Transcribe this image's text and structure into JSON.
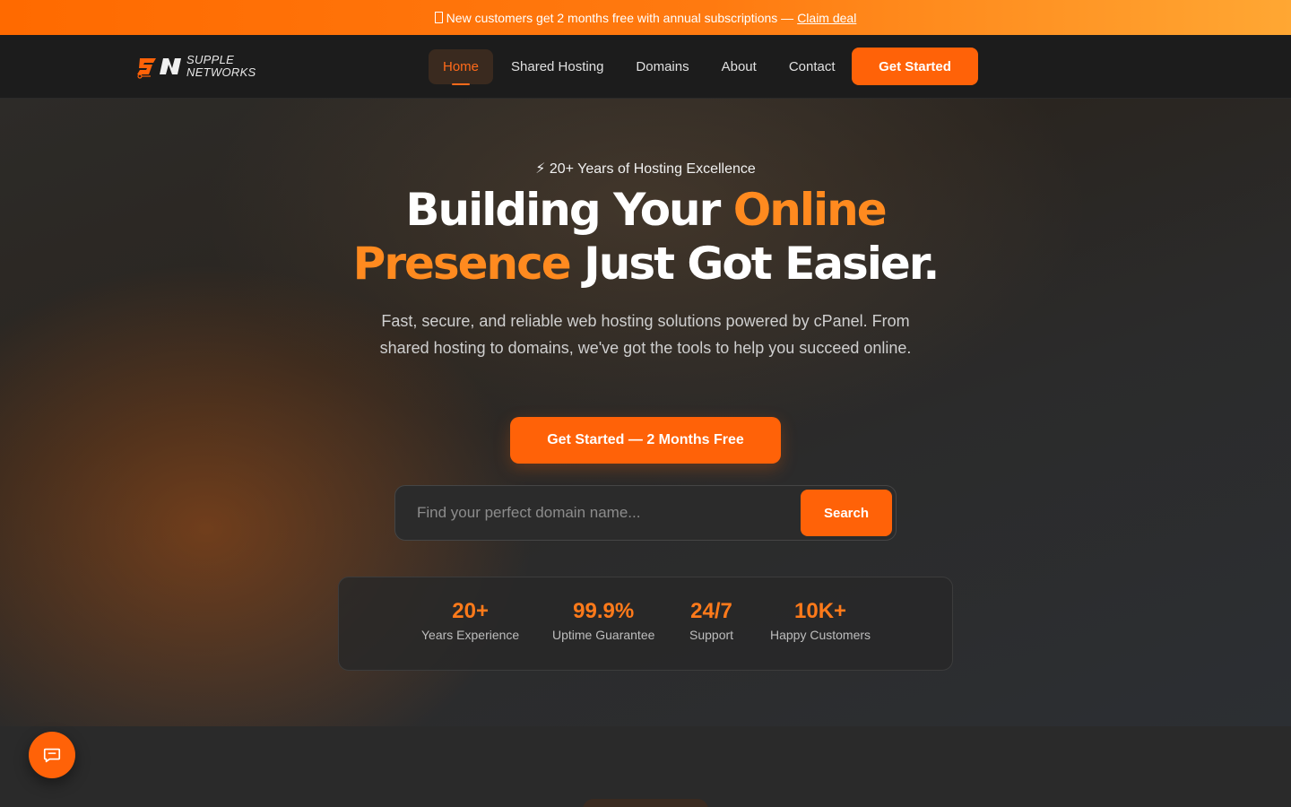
{
  "promo": {
    "icon": "gift-icon",
    "text": "New customers get 2 months free with annual subscriptions —",
    "link": "Claim deal"
  },
  "brand": {
    "line1": "SUPPLE",
    "line2": "NETWORKS",
    "accent_color": "#ff6208"
  },
  "nav": {
    "items": [
      {
        "label": "Home",
        "active": true
      },
      {
        "label": "Shared Hosting"
      },
      {
        "label": "Domains"
      },
      {
        "label": "About"
      },
      {
        "label": "Contact"
      }
    ],
    "cta": "Get Started"
  },
  "hero": {
    "eyebrow": "⚡ 20+ Years of Hosting Excellence",
    "headline": {
      "part1": "Building Your ",
      "accent1": "Online",
      "accent2": "Presence",
      "part2": " Just Got Easier."
    },
    "subtext": "Fast, secure, and reliable web hosting solutions powered by cPanel. From shared hosting to domains, we've got the tools to help you succeed online.",
    "cta": "Get Started — 2 Months Free"
  },
  "search": {
    "placeholder": "Find your perfect domain name...",
    "button": "Search"
  },
  "stats": [
    {
      "value": "20+",
      "label": "Years Experience"
    },
    {
      "value": "99.9%",
      "label": "Uptime Guarantee"
    },
    {
      "value": "24/7",
      "label": "Support"
    },
    {
      "value": "10K+",
      "label": "Happy Customers"
    }
  ],
  "chat": {
    "icon": "chat-icon"
  }
}
